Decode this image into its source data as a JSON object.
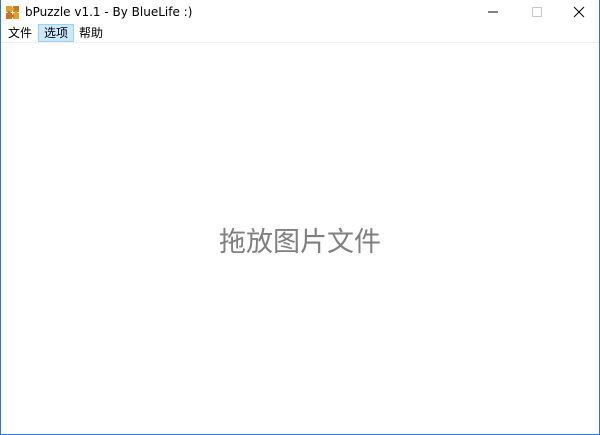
{
  "window": {
    "title": "bPuzzle v1.1 - By BlueLife :)",
    "app_icon": "puzzle-app-icon",
    "controls": {
      "minimize_icon": "minimize-icon",
      "maximize_icon": "maximize-icon",
      "close_icon": "close-icon"
    },
    "border_color": "#2b7bd4"
  },
  "menubar": {
    "items": [
      {
        "label": "文件"
      },
      {
        "label": "选项",
        "highlighted": true
      },
      {
        "label": "帮助"
      }
    ],
    "highlight_color": "#cce8ff"
  },
  "content": {
    "drop_hint": "拖放图片文件",
    "hint_color": "#808080"
  }
}
